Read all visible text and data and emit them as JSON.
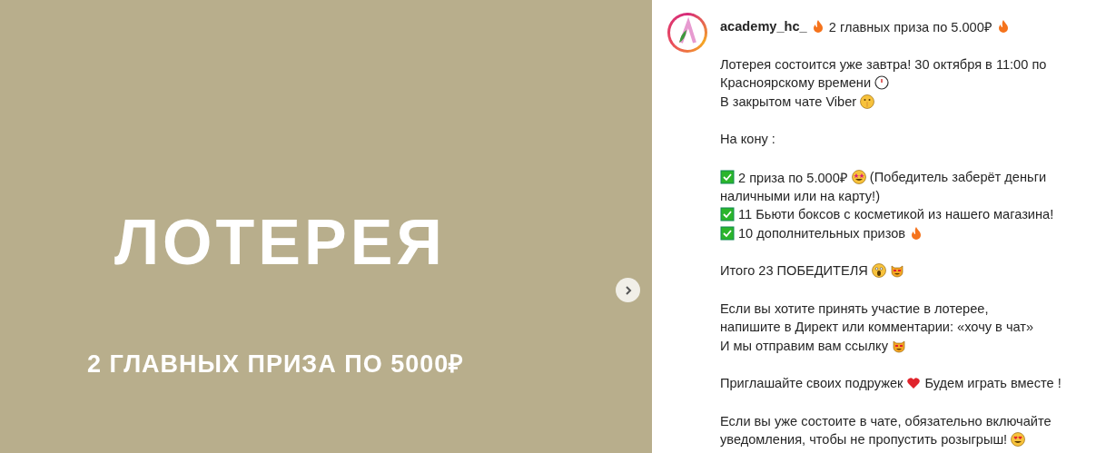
{
  "slide": {
    "title": "ЛОТЕРЕЯ",
    "subtitle": "2 ГЛАВНЫХ ПРИЗА ПО 5000₽"
  },
  "post": {
    "username": "academy_hc_",
    "headline": [
      {
        "kind": "emoji"
      },
      {
        "kind": "text",
        "text": "2 главных приза по 5.000₽"
      },
      {
        "kind": "emoji"
      }
    ],
    "paragraphs": [
      [
        [
          {
            "kind": "text",
            "text": "Лотерея состоится уже завтра! 30 октября в 11:00 по"
          }
        ],
        [
          {
            "kind": "text",
            "text": "Красноярскому времени"
          },
          {
            "kind": "emoji"
          }
        ],
        [
          {
            "kind": "text",
            "text": "В закрытом чате Viber"
          },
          {
            "kind": "emoji"
          }
        ]
      ],
      [
        [
          {
            "kind": "text",
            "text": "На кону :"
          }
        ]
      ],
      [
        [
          {
            "kind": "emoji"
          },
          {
            "kind": "text",
            "text": "2 приза по 5.000₽"
          },
          {
            "kind": "emoji"
          },
          {
            "kind": "text",
            "text": "(Победитель заберёт деньги"
          }
        ],
        [
          {
            "kind": "text",
            "text": "наличными или на карту!)"
          }
        ],
        [
          {
            "kind": "emoji"
          },
          {
            "kind": "text",
            "text": "11 Бьюти боксов с косметикой из нашего магазина!"
          }
        ],
        [
          {
            "kind": "emoji"
          },
          {
            "kind": "text",
            "text": "10 дополнительных призов"
          },
          {
            "kind": "emoji"
          }
        ]
      ],
      [
        [
          {
            "kind": "text",
            "text": "Итого 23 ПОБЕДИТЕЛЯ"
          },
          {
            "kind": "emoji"
          },
          {
            "kind": "emoji"
          }
        ]
      ],
      [
        [
          {
            "kind": "text",
            "text": "Если вы хотите принять участие в лотерее,"
          }
        ],
        [
          {
            "kind": "text",
            "text": "напишите в Директ или комментарии: «хочу в чат»"
          }
        ],
        [
          {
            "kind": "text",
            "text": "И мы отправим вам ссылку"
          },
          {
            "kind": "emoji"
          }
        ]
      ],
      [
        [
          {
            "kind": "text",
            "text": "Приглашайте своих подружек"
          },
          {
            "kind": "emoji"
          },
          {
            "kind": "text",
            "text": "Будем играть вместе !"
          }
        ]
      ],
      [
        [
          {
            "kind": "text",
            "text": "Если вы уже состоите в чате, обязательно включайте"
          }
        ],
        [
          {
            "kind": "text",
            "text": "уведомления, чтобы не пропустить розыгрыш!"
          },
          {
            "kind": "emoji"
          }
        ]
      ]
    ]
  }
}
